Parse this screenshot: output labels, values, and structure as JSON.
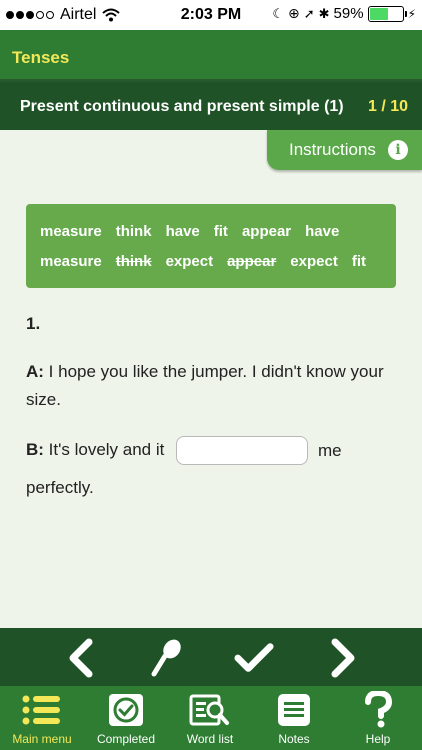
{
  "status_bar": {
    "carrier": "Airtel",
    "time": "2:03 PM",
    "battery": "59%",
    "battery_level": 0.59,
    "signal_bars": 3
  },
  "app": {
    "title": "Tenses"
  },
  "exercise": {
    "title": "Present continuous and present simple (1)",
    "progress": "1 / 10",
    "instructions_label": "Instructions"
  },
  "word_bank": {
    "rows": [
      [
        {
          "word": "measure",
          "used": false
        },
        {
          "word": "think",
          "used": false
        },
        {
          "word": "have",
          "used": false
        },
        {
          "word": "fit",
          "used": false
        },
        {
          "word": "appear",
          "used": false
        },
        {
          "word": "have",
          "used": false
        }
      ],
      [
        {
          "word": "measure",
          "used": false
        },
        {
          "word": "think",
          "used": true
        },
        {
          "word": "expect",
          "used": false
        },
        {
          "word": "appear",
          "used": true
        },
        {
          "word": "expect",
          "used": false
        },
        {
          "word": "fit",
          "used": false
        }
      ]
    ]
  },
  "question": {
    "number": "1.",
    "a_speaker": "A:",
    "a_text": " I hope you like the jumper. I didn't know your size.",
    "b_speaker": "B:",
    "b_text_before": " It's lovely and it",
    "answer_value": "",
    "b_text_after": "me",
    "b_text_end": "perfectly."
  },
  "actions": [
    "previous",
    "microphone",
    "check",
    "next"
  ],
  "tabs": [
    {
      "label": "Main menu",
      "icon": "list-icon",
      "active": true
    },
    {
      "label": "Completed",
      "icon": "completed-icon",
      "active": false
    },
    {
      "label": "Word list",
      "icon": "word-list-icon",
      "active": false
    },
    {
      "label": "Notes",
      "icon": "notes-icon",
      "active": false
    },
    {
      "label": "Help",
      "icon": "help-icon",
      "active": false
    }
  ],
  "colors": {
    "header_green": "#2e7d32",
    "dark_green": "#1f5226",
    "accent_yellow": "#f5e858",
    "word_bank_green": "#66aa4c",
    "background": "#eef4ea"
  }
}
